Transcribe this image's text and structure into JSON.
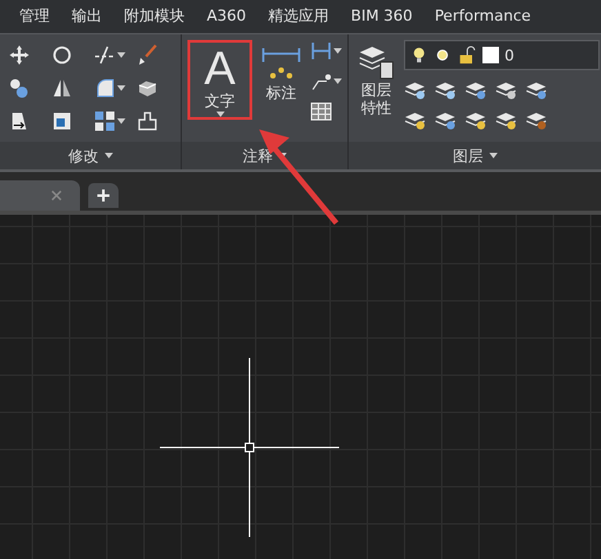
{
  "menu_tabs": [
    {
      "label": "管理"
    },
    {
      "label": "输出"
    },
    {
      "label": "附加模块"
    },
    {
      "label": "A360"
    },
    {
      "label": "精选应用"
    },
    {
      "label": "BIM 360"
    },
    {
      "label": "Performance"
    }
  ],
  "ribbon": {
    "panels": [
      {
        "kind": "modify",
        "title": "修改"
      },
      {
        "kind": "annotation",
        "title": "注释",
        "big_tools": [
          {
            "label": "文字",
            "glyph": "A",
            "highlighted": true
          },
          {
            "label": "标注",
            "highlighted": false
          }
        ]
      },
      {
        "kind": "layers",
        "title": "图层",
        "big_tool": {
          "label": "图层特性"
        },
        "layer_value": "0"
      }
    ]
  }
}
